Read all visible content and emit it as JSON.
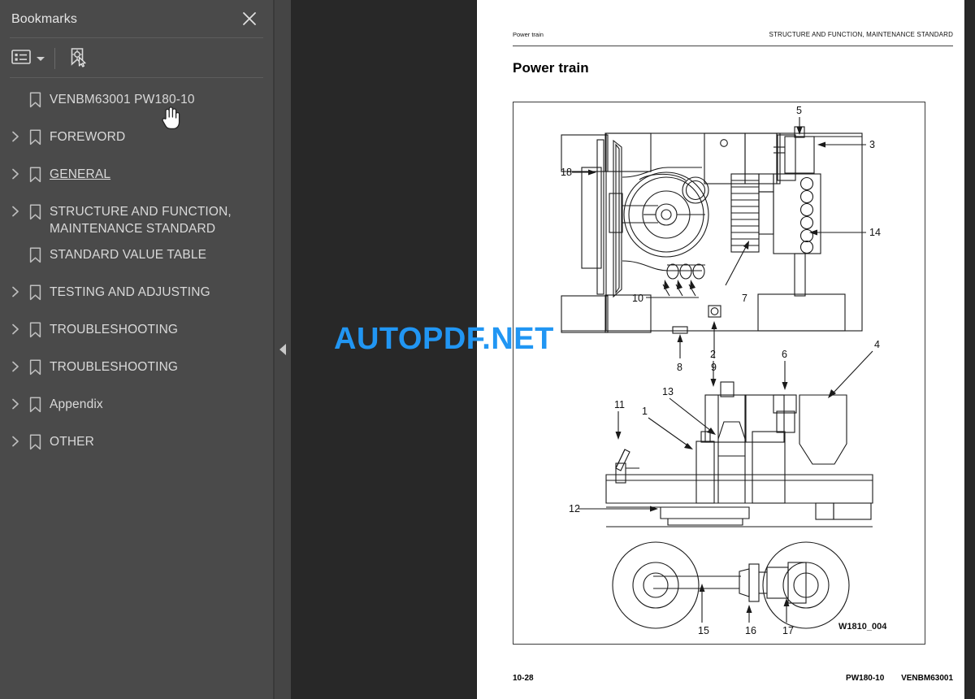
{
  "sidebar": {
    "title": "Bookmarks",
    "close_icon": "close-icon",
    "toolbar": {
      "listview_icon": "list-options-icon",
      "listview_caret": "chevron-down-icon",
      "find_bookmark_icon": "bookmark-pointer-icon"
    },
    "items": [
      {
        "label": "VENBM63001 PW180-10",
        "expandable": false,
        "underlined": false
      },
      {
        "label": "FOREWORD",
        "expandable": true,
        "underlined": false
      },
      {
        "label": "GENERAL",
        "expandable": true,
        "underlined": true
      },
      {
        "label": "STRUCTURE AND FUNCTION, MAINTENANCE STANDARD",
        "expandable": true,
        "underlined": false
      },
      {
        "label": "STANDARD VALUE TABLE",
        "expandable": false,
        "underlined": false
      },
      {
        "label": "TESTING AND ADJUSTING",
        "expandable": true,
        "underlined": false
      },
      {
        "label": "TROUBLESHOOTING",
        "expandable": true,
        "underlined": false
      },
      {
        "label": "TROUBLESHOOTING",
        "expandable": true,
        "underlined": false
      },
      {
        "label": "Appendix",
        "expandable": true,
        "underlined": false
      },
      {
        "label": "OTHER",
        "expandable": true,
        "underlined": false
      }
    ]
  },
  "splitter": {
    "collapse_icon": "chevron-left-icon"
  },
  "page": {
    "running_head_left": "Power train",
    "running_head_right": "STRUCTURE AND FUNCTION, MAINTENANCE STANDARD",
    "title": "Power train",
    "figure_id": "W1810_004",
    "footer_page": "10-28",
    "footer_model": "PW180-10",
    "footer_code": "VENBM63001",
    "callouts": [
      "1",
      "2",
      "3",
      "4",
      "5",
      "6",
      "7",
      "8",
      "9",
      "10",
      "11",
      "12",
      "13",
      "14",
      "15",
      "16",
      "17",
      "18"
    ]
  },
  "watermark": {
    "text": "AUTOPDF.NET",
    "color": "#2196f3"
  },
  "cursor": {
    "icon": "hand-pointer-cursor"
  },
  "colors": {
    "sidebar_bg": "#4a4a4a",
    "viewer_bg": "#282828",
    "page_bg": "#ffffff",
    "text": "#d9d9d9",
    "accent": "#2196f3"
  }
}
